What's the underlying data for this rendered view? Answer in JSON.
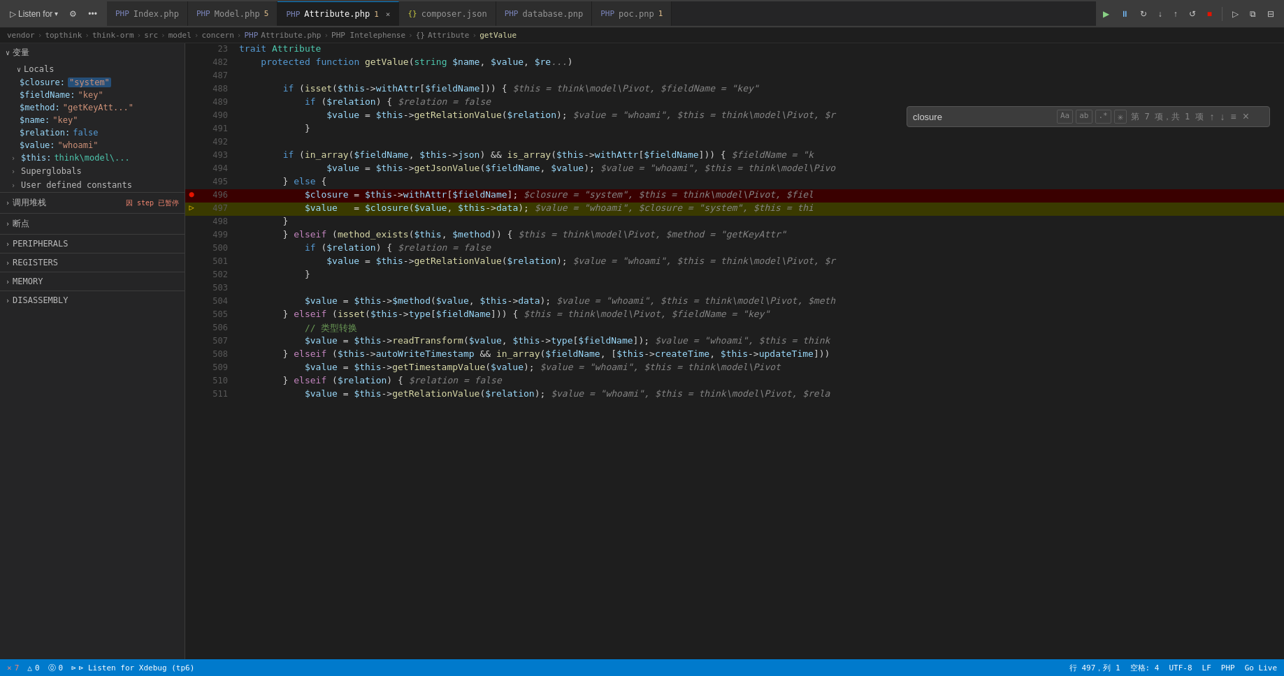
{
  "toolbar": {
    "listen_btn": "Listen for",
    "listen_suffix": "\\",
    "tabs": [
      {
        "id": "index",
        "label": "Index.php",
        "type": "php",
        "active": false,
        "modified": false
      },
      {
        "id": "model",
        "label": "Model.php",
        "type": "php",
        "active": false,
        "modified": true,
        "count": "5"
      },
      {
        "id": "attribute",
        "label": "Attribute.php",
        "type": "php",
        "active": true,
        "modified": true,
        "count": "1"
      },
      {
        "id": "composer",
        "label": "composer.json",
        "type": "json",
        "active": false,
        "modified": false
      },
      {
        "id": "database",
        "label": "database.pnp",
        "type": "php",
        "active": false,
        "modified": false
      },
      {
        "id": "poc",
        "label": "poc.pnp",
        "type": "php",
        "active": false,
        "modified": true,
        "count": "1"
      }
    ]
  },
  "breadcrumb": {
    "parts": [
      "vendor",
      "topthink",
      "think-orm",
      "src",
      "model",
      "concern",
      "Attribute.php",
      "PHP Intelephense",
      "{} Attribute",
      "getValue"
    ]
  },
  "search": {
    "placeholder": "closure",
    "value": "closure",
    "count": "第 7 项，共 1 项",
    "options": [
      "Aa",
      "ab",
      ".*"
    ]
  },
  "variables": {
    "section_label": "变量",
    "locals_label": "Locals",
    "items": [
      {
        "name": "$closure:",
        "value": "\"system\"",
        "type": "string",
        "highlighted": true
      },
      {
        "name": "$fieldName:",
        "value": "\"key\"",
        "type": "string"
      },
      {
        "name": "$method:",
        "value": "\"getKeyAtt...\"",
        "type": "string"
      },
      {
        "name": "$name:",
        "value": "\"key\"",
        "type": "string"
      },
      {
        "name": "$relation:",
        "value": "false",
        "type": "bool"
      },
      {
        "name": "$value:",
        "value": "\"whoami\"",
        "type": "string"
      },
      {
        "name": "$this:",
        "value": "think\\model\\...",
        "type": "object",
        "expandable": true
      }
    ],
    "superglobals_label": "Superglobals",
    "user_constants_label": "User defined constants"
  },
  "call_stack": {
    "label": "调用堆栈",
    "status": "因 step 已暂停"
  },
  "breakpoints": {
    "label": "断点"
  },
  "peripherals": {
    "label": "PERIPHERALS"
  },
  "registers": {
    "label": "REGISTERS"
  },
  "memory": {
    "label": "MEMORY"
  },
  "disassembly": {
    "label": "DISASSEMBLY"
  },
  "code": {
    "trait_line": {
      "num": "23",
      "content": "trait Attribute"
    },
    "func_line": {
      "num": "482",
      "content": "    protected function getValue(string $name, $value, $re..."
    },
    "lines": [
      {
        "num": "487",
        "content": "",
        "type": "empty"
      },
      {
        "num": "488",
        "content": "        if (isset($this->withAttr[$fieldName])) { $this = think\\model\\Pivot, $fieldName = \"key\"",
        "type": "code"
      },
      {
        "num": "489",
        "content": "            if ($relation) { $relation = false",
        "type": "code"
      },
      {
        "num": "490",
        "content": "                $value = $this->getRelationValue($relation); $value = \"whoami\", $this = think\\model\\Pivot, $r",
        "type": "code"
      },
      {
        "num": "491",
        "content": "            }",
        "type": "code"
      },
      {
        "num": "492",
        "content": "",
        "type": "empty"
      },
      {
        "num": "493",
        "content": "        if (in_array($fieldName, $this->json) && is_array($this->withAttr[$fieldName])) { $fieldName = \"k",
        "type": "code"
      },
      {
        "num": "494",
        "content": "                $value = $this->getJsonValue($fieldName, $value); $value = \"whoami\", $this = think\\model\\Pivo",
        "type": "code"
      },
      {
        "num": "495",
        "content": "        } else {",
        "type": "code"
      },
      {
        "num": "496",
        "content": "            $closure = $this->withAttr[$fieldName]; $closure = \"system\", $this = think\\model\\Pivot, $fiel",
        "type": "code",
        "breakpoint": true
      },
      {
        "num": "497",
        "content": "            $value   = $closure($value, $this->data); $value = \"whoami\", $closure = \"system\", $this = thi",
        "type": "code",
        "debug_arrow": true
      },
      {
        "num": "498",
        "content": "        }",
        "type": "code"
      },
      {
        "num": "499",
        "content": "        } elseif (method_exists($this, $method)) { $this = think\\model\\Pivot, $method = \"getKeyAttr\"",
        "type": "code"
      },
      {
        "num": "500",
        "content": "            if ($relation) { $relation = false",
        "type": "code"
      },
      {
        "num": "501",
        "content": "                $value = $this->getRelationValue($relation); $value = \"whoami\", $this = think\\model\\Pivot, $r",
        "type": "code"
      },
      {
        "num": "502",
        "content": "            }",
        "type": "code"
      },
      {
        "num": "503",
        "content": "",
        "type": "empty"
      },
      {
        "num": "504",
        "content": "            $value = $this->$method($value, $this->data); $value = \"whoami\", $this = think\\model\\Pivot, $meth",
        "type": "code"
      },
      {
        "num": "505",
        "content": "        } elseif (isset($this->type[$fieldName])) { $this = think\\model\\Pivot, $fieldName = \"key\"",
        "type": "code"
      },
      {
        "num": "506",
        "content": "            // 类型转换",
        "type": "code"
      },
      {
        "num": "507",
        "content": "            $value = $this->readTransform($value, $this->type[$fieldName]); $value = \"whoami\", $this = think",
        "type": "code"
      },
      {
        "num": "508",
        "content": "        } elseif ($this->autoWriteTimestamp && in_array($fieldName, [$this->createTime, $this->updateTime]))",
        "type": "code"
      },
      {
        "num": "509",
        "content": "            $value = $this->getTimestampValue($value); $value = \"whoami\", $this = think\\model\\Pivot",
        "type": "code"
      },
      {
        "num": "510",
        "content": "        } elseif ($relation) { $relation = false",
        "type": "code"
      },
      {
        "num": "511",
        "content": "            $value = $this->getRelationValue($relation); $value = \"whoami\", $this = think\\model\\Pivot, $rela",
        "type": "code"
      }
    ]
  },
  "statusbar": {
    "errors": "× 7",
    "warnings": "△ 0",
    "info": "⓪ 0",
    "listen": "⊳ Listen for Xdebug (tp6)",
    "line": "行 497，列 1",
    "spaces": "空格: 4",
    "encoding": "UTF-8",
    "line_ending": "LF",
    "language": "PHP",
    "go_live": "Go Live"
  }
}
